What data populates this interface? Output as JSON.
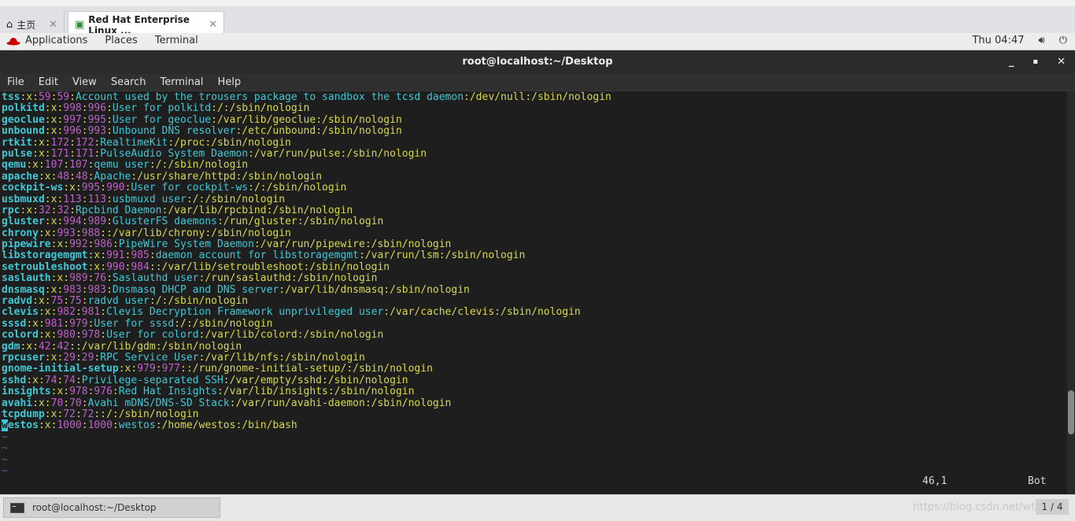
{
  "browser": {
    "tabs": [
      {
        "label": "主页",
        "icon": "home-icon"
      },
      {
        "label": "Red Hat Enterprise Linux ...",
        "icon": "vm-icon"
      }
    ],
    "close_symbol": "✕"
  },
  "topbar": {
    "applications": "Applications",
    "places": "Places",
    "terminal": "Terminal",
    "clock": "Thu 04:47"
  },
  "window": {
    "title": "root@localhost:~/Desktop",
    "minimize": "_",
    "maximize": "▪",
    "close": "✕"
  },
  "menu": [
    "File",
    "Edit",
    "View",
    "Search",
    "Terminal",
    "Help"
  ],
  "passwd_lines": [
    [
      "tss",
      "x",
      "59",
      "59",
      "Account used by the trousers package to sandbox the tcsd daemon",
      "/dev/null",
      "/sbin/nologin"
    ],
    [
      "polkitd",
      "x",
      "998",
      "996",
      "User for polkitd",
      "/",
      "/sbin/nologin"
    ],
    [
      "geoclue",
      "x",
      "997",
      "995",
      "User for geoclue",
      "/var/lib/geoclue",
      "/sbin/nologin"
    ],
    [
      "unbound",
      "x",
      "996",
      "993",
      "Unbound DNS resolver",
      "/etc/unbound",
      "/sbin/nologin"
    ],
    [
      "rtkit",
      "x",
      "172",
      "172",
      "RealtimeKit",
      "/proc",
      "/sbin/nologin"
    ],
    [
      "pulse",
      "x",
      "171",
      "171",
      "PulseAudio System Daemon",
      "/var/run/pulse",
      "/sbin/nologin"
    ],
    [
      "qemu",
      "x",
      "107",
      "107",
      "qemu user",
      "/",
      "/sbin/nologin"
    ],
    [
      "apache",
      "x",
      "48",
      "48",
      "Apache",
      "/usr/share/httpd",
      "/sbin/nologin"
    ],
    [
      "cockpit-ws",
      "x",
      "995",
      "990",
      "User for cockpit-ws",
      "/",
      "/sbin/nologin"
    ],
    [
      "usbmuxd",
      "x",
      "113",
      "113",
      "usbmuxd user",
      "/",
      "/sbin/nologin"
    ],
    [
      "rpc",
      "x",
      "32",
      "32",
      "Rpcbind Daemon",
      "/var/lib/rpcbind",
      "/sbin/nologin"
    ],
    [
      "gluster",
      "x",
      "994",
      "989",
      "GlusterFS daemons",
      "/run/gluster",
      "/sbin/nologin"
    ],
    [
      "chrony",
      "x",
      "993",
      "988",
      "",
      "/var/lib/chrony",
      "/sbin/nologin"
    ],
    [
      "pipewire",
      "x",
      "992",
      "986",
      "PipeWire System Daemon",
      "/var/run/pipewire",
      "/sbin/nologin"
    ],
    [
      "libstoragemgmt",
      "x",
      "991",
      "985",
      "daemon account for libstoragemgmt",
      "/var/run/lsm",
      "/sbin/nologin"
    ],
    [
      "setroubleshoot",
      "x",
      "990",
      "984",
      "",
      "/var/lib/setroubleshoot",
      "/sbin/nologin"
    ],
    [
      "saslauth",
      "x",
      "989",
      "76",
      "Saslauthd user",
      "/run/saslauthd",
      "/sbin/nologin"
    ],
    [
      "dnsmasq",
      "x",
      "983",
      "983",
      "Dnsmasq DHCP and DNS server",
      "/var/lib/dnsmasq",
      "/sbin/nologin"
    ],
    [
      "radvd",
      "x",
      "75",
      "75",
      "radvd user",
      "/",
      "/sbin/nologin"
    ],
    [
      "clevis",
      "x",
      "982",
      "981",
      "Clevis Decryption Framework unprivileged user",
      "/var/cache/clevis",
      "/sbin/nologin"
    ],
    [
      "sssd",
      "x",
      "981",
      "979",
      "User for sssd",
      "/",
      "/sbin/nologin"
    ],
    [
      "colord",
      "x",
      "980",
      "978",
      "User for colord",
      "/var/lib/colord",
      "/sbin/nologin"
    ],
    [
      "gdm",
      "x",
      "42",
      "42",
      "",
      "/var/lib/gdm",
      "/sbin/nologin"
    ],
    [
      "rpcuser",
      "x",
      "29",
      "29",
      "RPC Service User",
      "/var/lib/nfs",
      "/sbin/nologin"
    ],
    [
      "gnome-initial-setup",
      "x",
      "979",
      "977",
      "",
      "/run/gnome-initial-setup/",
      "/sbin/nologin"
    ],
    [
      "sshd",
      "x",
      "74",
      "74",
      "Privilege-separated SSH",
      "/var/empty/sshd",
      "/sbin/nologin"
    ],
    [
      "insights",
      "x",
      "978",
      "976",
      "Red Hat Insights",
      "/var/lib/insights",
      "/sbin/nologin"
    ],
    [
      "avahi",
      "x",
      "70",
      "70",
      "Avahi mDNS/DNS-SD Stack",
      "/var/run/avahi-daemon",
      "/sbin/nologin"
    ],
    [
      "tcpdump",
      "x",
      "72",
      "72",
      "",
      "/",
      "/sbin/nologin"
    ],
    [
      "westos",
      "x",
      "1000",
      "1000",
      "westos",
      "/home/westos",
      "/bin/bash"
    ]
  ],
  "tilde_lines": [
    "~",
    "~",
    "~",
    "~"
  ],
  "vim_status": {
    "position": "46,1",
    "scroll": "Bot"
  },
  "taskbar": {
    "task_label": "root@localhost:~/Desktop",
    "watermark": "https://blog.csdn.net/wf...",
    "pager": "1 / 4"
  }
}
